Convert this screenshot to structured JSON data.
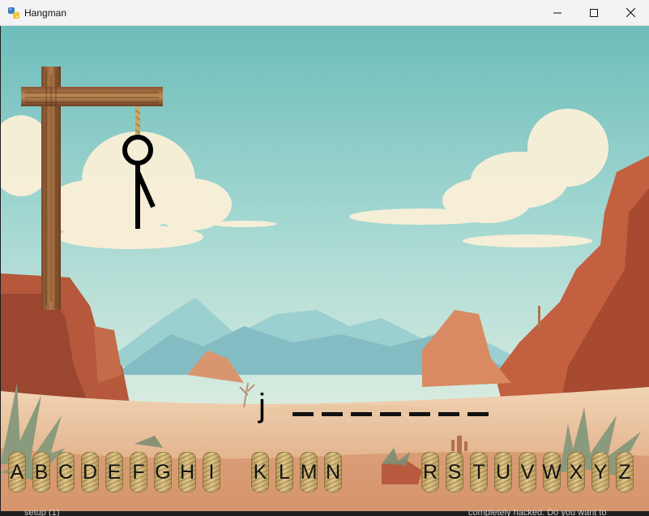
{
  "window": {
    "title": "Hangman",
    "icon": "python-icon"
  },
  "controls": {
    "minimize": "minimize-icon",
    "maximize": "maximize-icon",
    "close": "close-icon"
  },
  "game": {
    "last_guess": "j",
    "word_length": 7,
    "keys": [
      {
        "letter": "A"
      },
      {
        "letter": "B"
      },
      {
        "letter": "C"
      },
      {
        "letter": "D"
      },
      {
        "letter": "E"
      },
      {
        "letter": "F"
      },
      {
        "letter": "G"
      },
      {
        "letter": "H"
      },
      {
        "letter": "I"
      },
      {
        "letter": "K"
      },
      {
        "letter": "L"
      },
      {
        "letter": "M"
      },
      {
        "letter": "N"
      },
      {
        "letter": "R"
      },
      {
        "letter": "S"
      },
      {
        "letter": "T"
      },
      {
        "letter": "U"
      },
      {
        "letter": "V"
      },
      {
        "letter": "W"
      },
      {
        "letter": "X"
      },
      {
        "letter": "Y"
      },
      {
        "letter": "Z"
      }
    ],
    "colors": {
      "sky": "#7ec8c6",
      "desert": "#e2b48e",
      "rock": "#c8694a",
      "rope": "#d8bc7a"
    }
  },
  "taskbar": {
    "left_text": "setup (1)",
    "right_text": "completely hacked. Do you want to"
  }
}
